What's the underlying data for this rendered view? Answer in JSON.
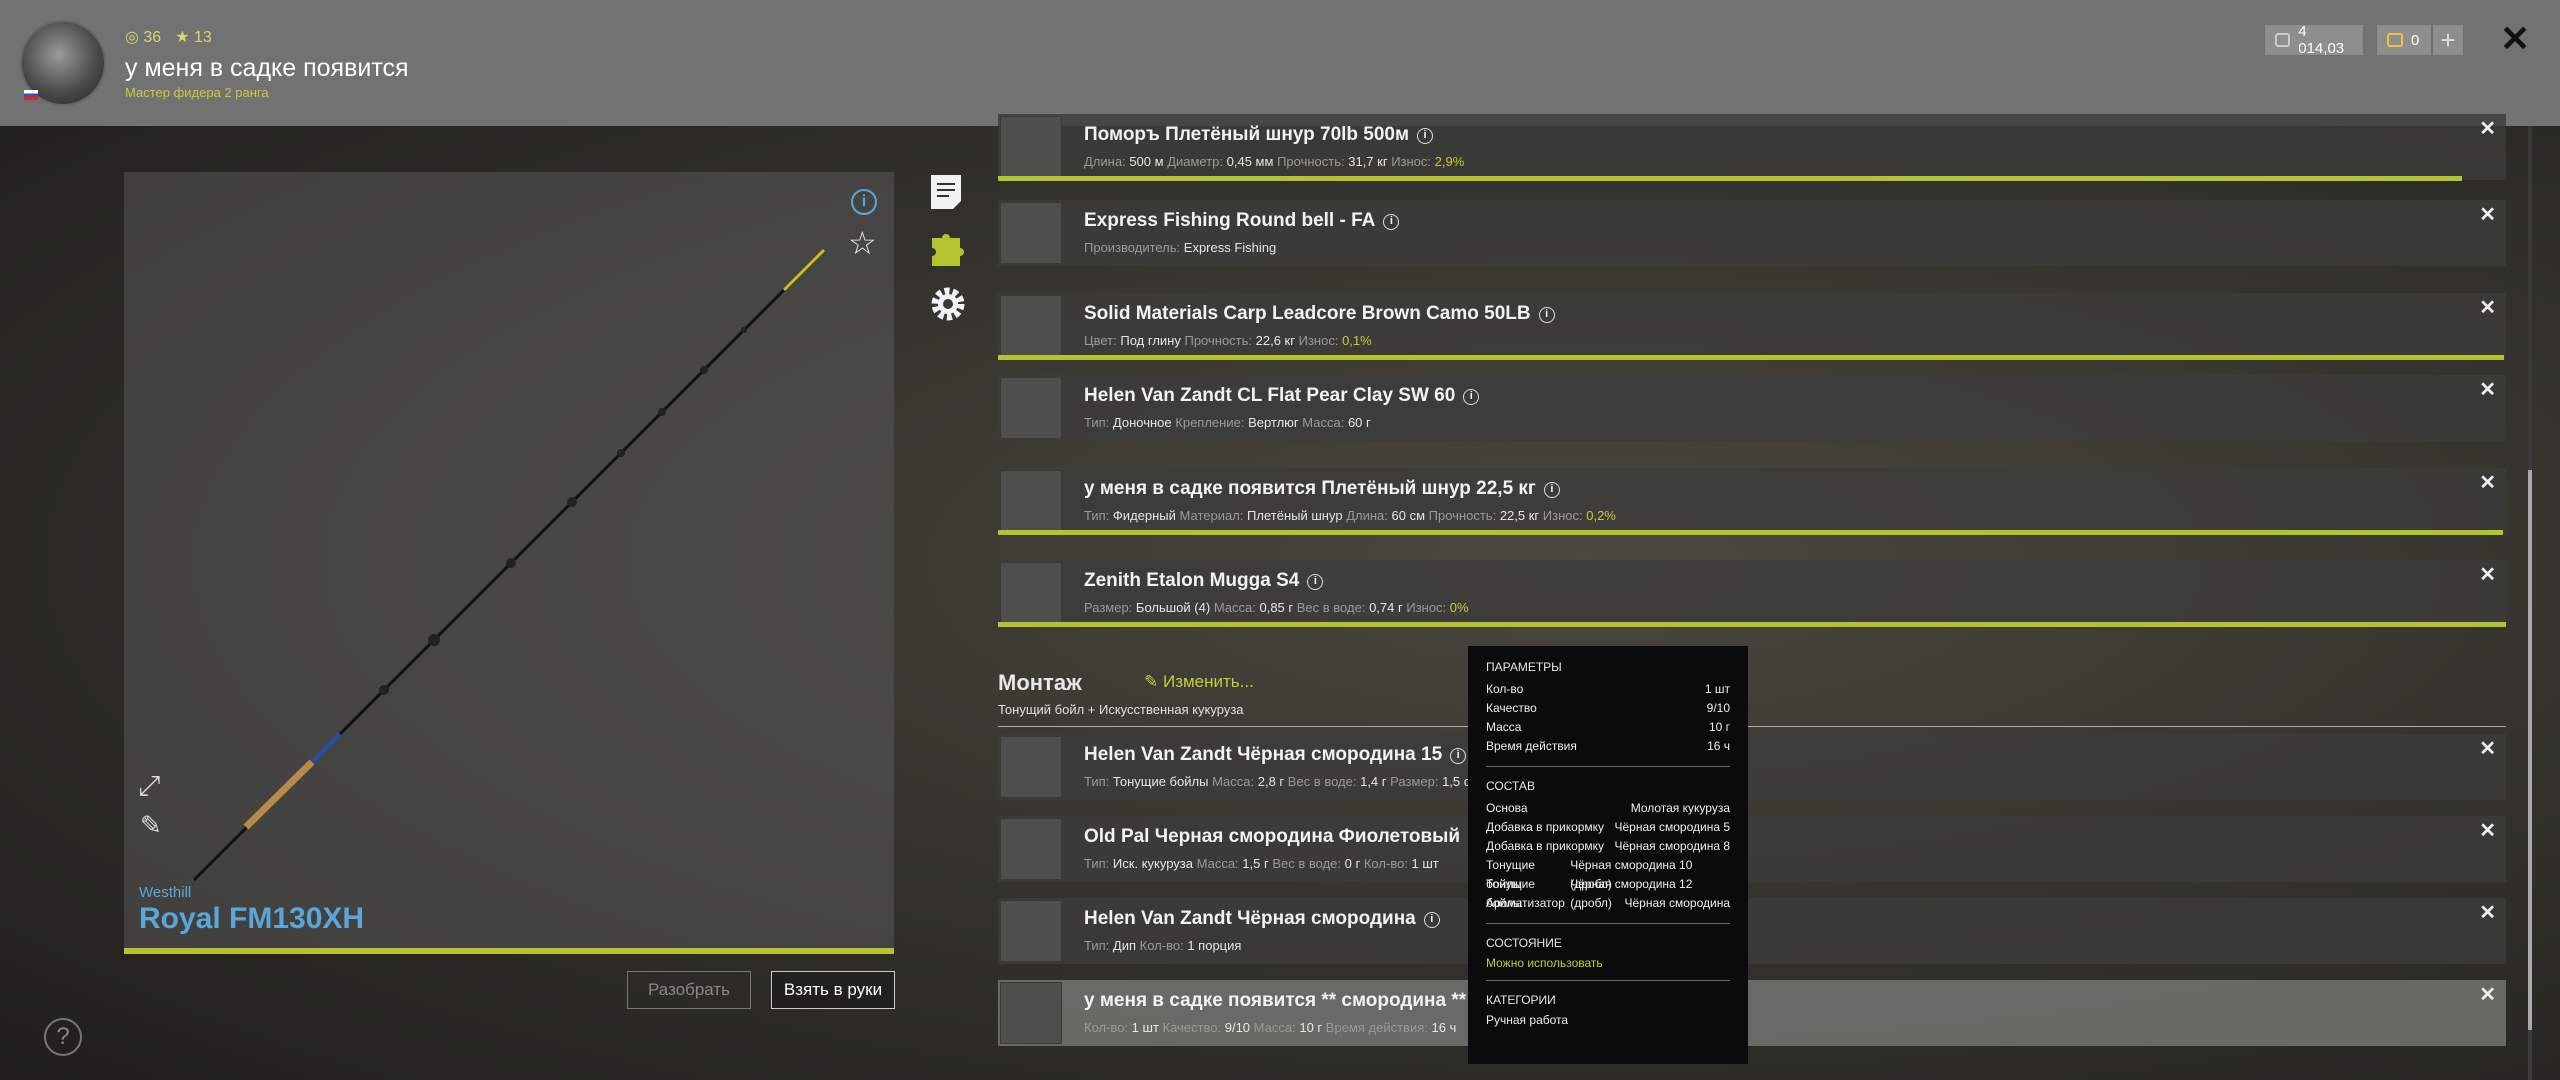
{
  "player": {
    "level": "36",
    "stars": "13",
    "name": "у меня в садке появится",
    "rank": "Мастер фидера 2 ранга"
  },
  "currency": {
    "silver": "4 014,03",
    "gold": "0"
  },
  "rod": {
    "brand": "Westhill",
    "name": "Royal FM130XH"
  },
  "buttons": {
    "disassemble": "Разобрать",
    "take": "Взять в руки"
  },
  "tackle": [
    {
      "name": "Поморъ Плетёный шнур 70lb 500м",
      "attrs": [
        [
          "Длина:",
          "500 м"
        ],
        [
          "Диаметр:",
          "0,45 мм"
        ],
        [
          "Прочность:",
          "31,7 кг"
        ],
        [
          "Износ:",
          "2,9%"
        ]
      ],
      "wear": 0.971
    },
    {
      "name": "Express Fishing Round bell - FA",
      "attrs": [
        [
          "Производитель:",
          "Express Fishing"
        ]
      ],
      "wear": null
    },
    {
      "name": "Solid Materials Carp Leadcore Brown Camo 50LB",
      "attrs": [
        [
          "Цвет:",
          "Под глину"
        ],
        [
          "Прочность:",
          "22,6 кг"
        ],
        [
          "Износ:",
          "0,1%"
        ]
      ],
      "wear": 0.999
    },
    {
      "name": "Helen Van Zandt CL Flat Pear Clay SW 60",
      "attrs": [
        [
          "Тип:",
          "Доночное"
        ],
        [
          "Крепление:",
          "Вертлюг"
        ],
        [
          "Масса:",
          "60 г"
        ]
      ],
      "wear": null
    },
    {
      "name": "у меня в садке появится Плетёный шнур 22,5 кг",
      "attrs": [
        [
          "Тип:",
          "Фидерный"
        ],
        [
          "Материал:",
          "Плетёный шнур"
        ],
        [
          "Длина:",
          "60 см"
        ],
        [
          "Прочность:",
          "22,5 кг"
        ],
        [
          "Износ:",
          "0,2%"
        ]
      ],
      "wear": 0.998
    },
    {
      "name": "Zenith Etalon Mugga S4",
      "attrs": [
        [
          "Размер:",
          "Большой (4)"
        ],
        [
          "Масса:",
          "0,85 г"
        ],
        [
          "Вес в воде:",
          "0,74 г"
        ],
        [
          "Износ:",
          "0%"
        ]
      ],
      "wear": 1.0
    }
  ],
  "montage": {
    "title": "Монтаж",
    "change": "Изменить...",
    "subtitle": "Тонущий бойл  +  Искусственная кукуруза"
  },
  "baits": [
    {
      "name": "Helen Van Zandt Чёрная смородина 15",
      "attrs": [
        [
          "Тип:",
          "Тонущие бойлы"
        ],
        [
          "Масса:",
          "2,8 г"
        ],
        [
          "Вес в воде:",
          "1,4 г"
        ],
        [
          "Размер:",
          "1,5 с"
        ]
      ]
    },
    {
      "name": "Old Pal Черная смородина Фиолетовый",
      "attrs": [
        [
          "Тип:",
          "Иск. кукуруза"
        ],
        [
          "Масса:",
          "1,5 г"
        ],
        [
          "Вес в воде:",
          "0 г"
        ],
        [
          "Кол-во:",
          "1 шт"
        ]
      ]
    },
    {
      "name": "Helen Van Zandt Чёрная смородина",
      "attrs": [
        [
          "Тип:",
          "Дип"
        ],
        [
          "Кол-во:",
          "1 порция"
        ]
      ]
    },
    {
      "name": "у меня в садке появится ** смородина **",
      "attrs": [
        [
          "Кол-во:",
          "1 шт"
        ],
        [
          "Качество:",
          "9/10"
        ],
        [
          "Масса:",
          "10 г"
        ],
        [
          "Время действия:",
          "16 ч"
        ]
      ]
    }
  ],
  "tooltip": {
    "params_title": "ПАРАМЕТРЫ",
    "params": [
      [
        "Кол-во",
        "1 шт"
      ],
      [
        "Качество",
        "9/10"
      ],
      [
        "Масса",
        "10 г"
      ],
      [
        "Время действия",
        "16 ч"
      ]
    ],
    "composition_title": "СОСТАВ",
    "composition": [
      [
        "Основа",
        "Молотая кукуруза"
      ],
      [
        "Добавка в прикормку",
        "Чёрная смородина 5"
      ],
      [
        "Добавка в прикормку",
        "Чёрная смородина 8"
      ],
      [
        "Тонущие бойлы",
        "Чёрная смородина 10 (дробл)"
      ],
      [
        "Тонущие бойлы",
        "Чёрная смородина 12 (дробл)"
      ],
      [
        "Ароматизатор",
        "Чёрная смородина"
      ]
    ],
    "state_title": "СОСТОЯНИЕ",
    "state": "Можно использовать",
    "categories_title": "КАТЕГОРИИ",
    "category": "Ручная работа"
  },
  "icons": [
    "info-icon",
    "star-icon",
    "document-icon",
    "puzzle-icon",
    "gear-icon",
    "expand-icon",
    "pencil-icon",
    "help-icon",
    "close-icon",
    "coin-icon",
    "gold-icon",
    "plus-icon",
    "edit-icon"
  ],
  "colors": {
    "accent": "#b5c42e",
    "rod_name": "#5aa6d8",
    "topbar": "#787878"
  }
}
